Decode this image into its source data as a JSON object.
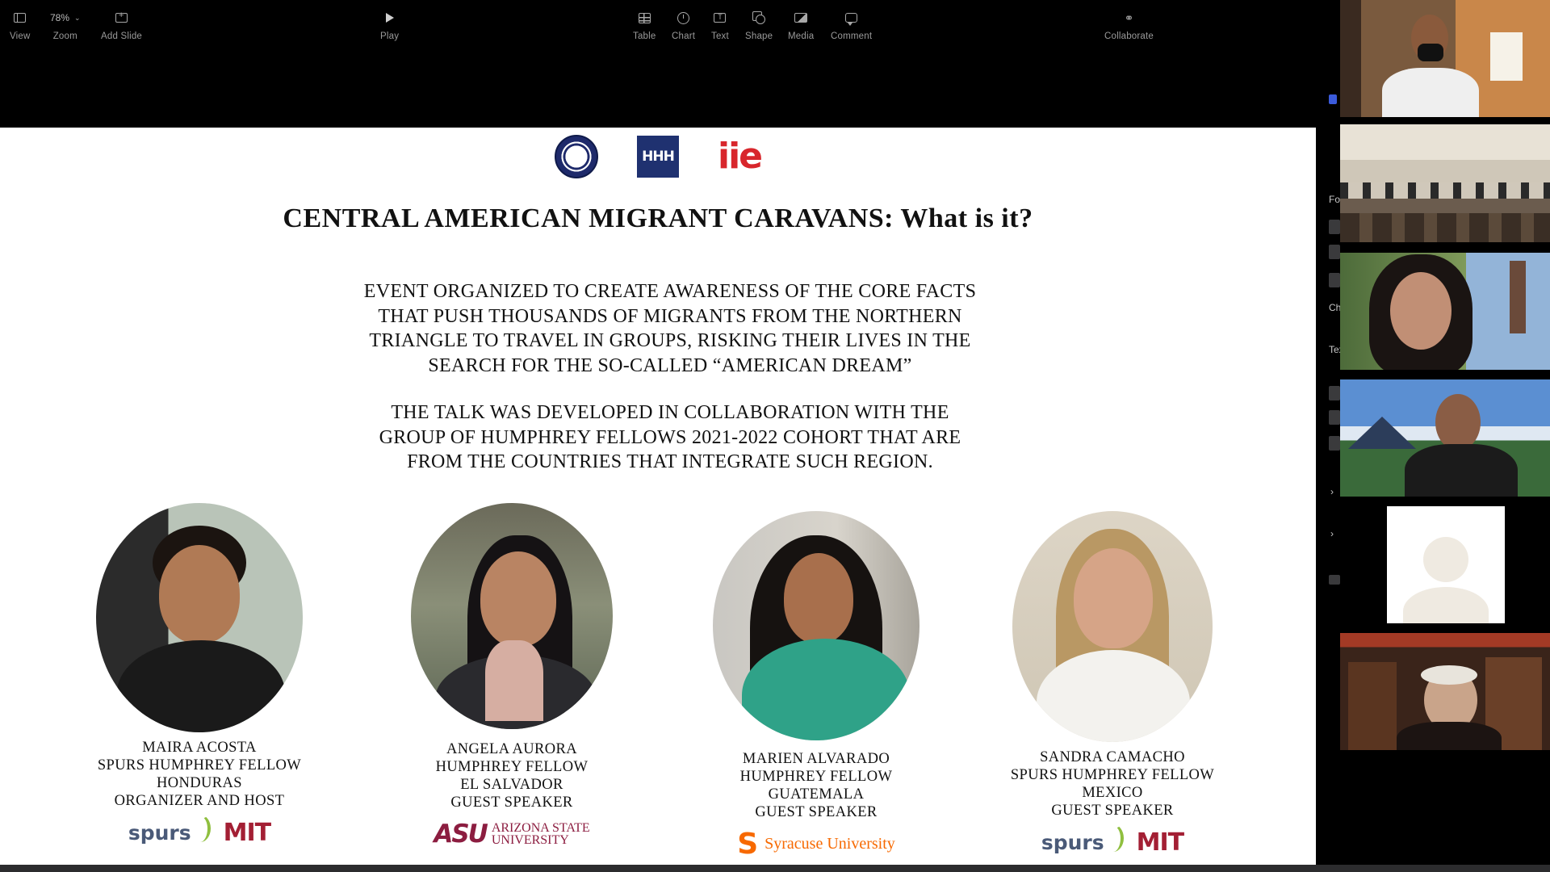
{
  "toolbar": {
    "view_label": "View",
    "zoom_value": "78%",
    "zoom_label": "Zoom",
    "add_slide_label": "Add Slide",
    "play_label": "Play",
    "table_label": "Table",
    "chart_label": "Chart",
    "text_label": "Text",
    "shape_label": "Shape",
    "media_label": "Media",
    "comment_label": "Comment",
    "collaborate_label": "Collaborate"
  },
  "slide": {
    "logos": [
      "us-department-of-state-seal",
      "humphrey-fellowship-logo",
      "iie-logo"
    ],
    "iie_text": "iie",
    "title": "CENTRAL AMERICAN MIGRANT CARAVANS: What is it?",
    "paragraph1": [
      "EVENT  ORGANIZED TO CREATE AWARENESS OF THE CORE FACTS",
      "THAT PUSH THOUSANDS OF MIGRANTS FROM THE NORTHERN",
      "TRIANGLE TO TRAVEL IN GROUPS, RISKING THEIR LIVES IN THE",
      "SEARCH FOR THE SO-CALLED “AMERICAN DREAM”"
    ],
    "paragraph2": [
      "THE TALK WAS DEVELOPED IN COLLABORATION WITH THE",
      "GROUP OF  HUMPHREY FELLOWS  2021-2022 COHORT THAT ARE",
      "FROM THE COUNTRIES THAT INTEGRATE SUCH REGION."
    ],
    "speakers": [
      {
        "lines": [
          "MAIRA ACOSTA",
          "SPURS HUMPHREY FELLOW",
          "HONDURAS",
          "ORGANIZER AND HOST"
        ],
        "logos": [
          "spurs",
          "MIT"
        ]
      },
      {
        "lines": [
          "ANGELA  AURORA",
          "HUMPHREY FELLOW",
          "EL SALVADOR",
          "GUEST SPEAKER"
        ],
        "logos": [
          "ASU Arizona State University"
        ]
      },
      {
        "lines": [
          "MARIEN ALVARADO",
          "HUMPHREY FELLOW",
          "GUATEMALA",
          "GUEST SPEAKER"
        ],
        "logos": [
          "Syracuse University"
        ]
      },
      {
        "lines": [
          "SANDRA  CAMACHO",
          "SPURS HUMPHREY FELLOW",
          "MEXICO",
          "GUEST SPEAKER"
        ],
        "logos": [
          "spurs",
          "MIT"
        ]
      }
    ],
    "logo_text": {
      "spurs": "spurs",
      "mit": "MIT",
      "asu_mark": "ASU",
      "asu_line1": "ARIZONA STATE",
      "asu_line2": "UNIVERSITY",
      "syr_mark": "S",
      "syr_text": "Syracuse University"
    }
  },
  "side_panel": {
    "fragments": [
      "Fo",
      "Ch",
      "Tex"
    ]
  }
}
